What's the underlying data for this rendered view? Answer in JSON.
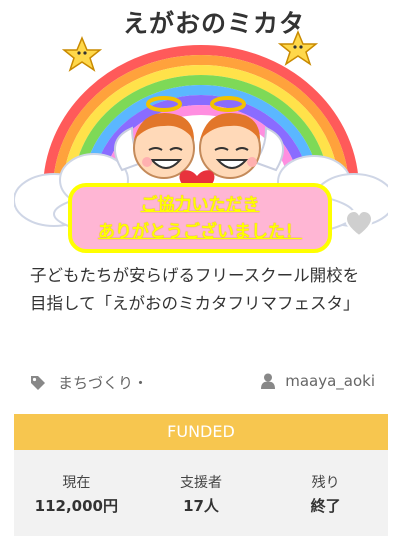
{
  "hero": {
    "title": "えがおのミカタ",
    "banner_line1": "ご協力いただき",
    "banner_line2": "ありがとうございました！"
  },
  "project": {
    "title": "子どもたちが安らげるフリースクール開校を目指して「えがおのミカタフリマフェスタ」",
    "category": "まちづくり・",
    "owner": "maaya_aoki",
    "status": "FUNDED"
  },
  "stats": [
    {
      "label": "現在",
      "value": "112,000円"
    },
    {
      "label": "支援者",
      "value": "17人"
    },
    {
      "label": "残り",
      "value": "終了"
    }
  ],
  "icons": {
    "category": "tag-icon",
    "owner": "user-icon",
    "favorite": "heart-icon"
  },
  "colors": {
    "status_bar": "#f7c64f",
    "stats_bg": "#f2f2f2",
    "banner_bg": "#ffb6d4",
    "banner_text": "#ffff00"
  }
}
